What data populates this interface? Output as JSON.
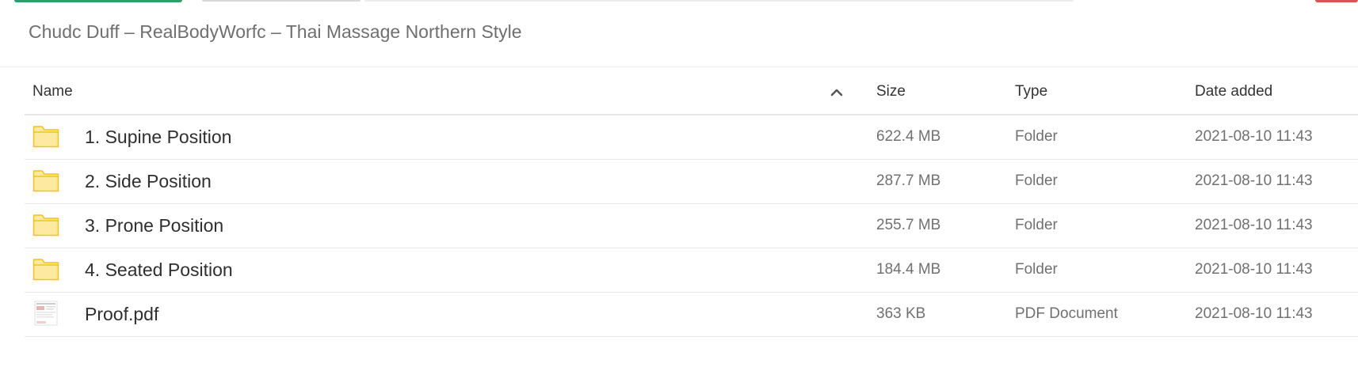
{
  "window": {
    "title": "Chudc Duff – RealBodyWorfc – Thai Massage Northern Style"
  },
  "table": {
    "columns": {
      "name": "Name",
      "size": "Size",
      "type": "Type",
      "date": "Date added"
    },
    "sort": {
      "column": "name",
      "direction": "ascending",
      "icon": "chevron-up-icon"
    },
    "rows": [
      {
        "icon": "folder-icon",
        "name": "1. Supine Position",
        "size": "622.4 MB",
        "type": "Folder",
        "date": "2021-08-10 11:43"
      },
      {
        "icon": "folder-icon",
        "name": "2. Side Position",
        "size": "287.7 MB",
        "type": "Folder",
        "date": "2021-08-10 11:43"
      },
      {
        "icon": "folder-icon",
        "name": "3. Prone Position",
        "size": "255.7 MB",
        "type": "Folder",
        "date": "2021-08-10 11:43"
      },
      {
        "icon": "folder-icon",
        "name": "4. Seated Position",
        "size": "184.4 MB",
        "type": "Folder",
        "date": "2021-08-10 11:43"
      },
      {
        "icon": "pdf-thumbnail-icon",
        "name": "Proof.pdf",
        "size": "363 KB",
        "type": "PDF Document",
        "date": "2021-08-10 11:43"
      }
    ]
  },
  "colors": {
    "folder_fill": "#fde9a0",
    "folder_stroke": "#f0c419",
    "accent_green": "#2e9e6b",
    "accent_red": "#d9534f"
  }
}
